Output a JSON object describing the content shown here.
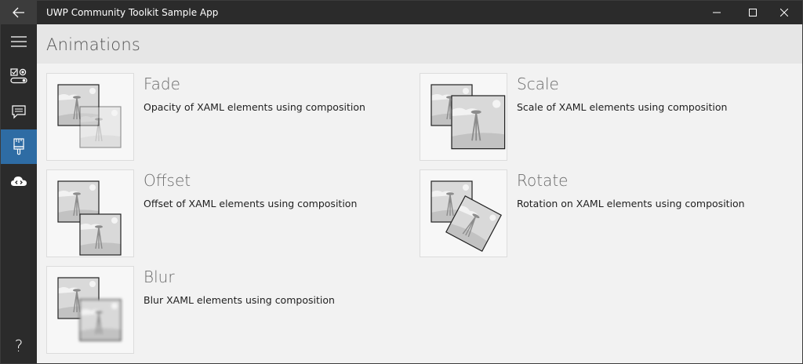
{
  "app": {
    "title": "UWP Community Toolkit Sample App"
  },
  "titlebar": {
    "back_icon": "arrow-left-icon",
    "minimize_icon": "minimize-icon",
    "maximize_icon": "maximize-icon",
    "close_icon": "close-icon"
  },
  "nav": {
    "items": [
      {
        "icon": "hamburger-menu-icon",
        "selected": false
      },
      {
        "icon": "controls-icon",
        "selected": false
      },
      {
        "icon": "notifications-icon",
        "selected": false
      },
      {
        "icon": "brush-icon",
        "selected": true
      },
      {
        "icon": "cloud-code-icon",
        "selected": false
      }
    ],
    "help_label": "?"
  },
  "header": {
    "title": "Animations"
  },
  "samples": [
    {
      "title": "Fade",
      "description": "Opacity of XAML elements using composition",
      "thumbnail": "fade"
    },
    {
      "title": "Scale",
      "description": "Scale of XAML elements using composition",
      "thumbnail": "scale"
    },
    {
      "title": "Offset",
      "description": "Offset of XAML elements using composition",
      "thumbnail": "offset"
    },
    {
      "title": "Rotate",
      "description": "Rotation on XAML elements using composition",
      "thumbnail": "rotate"
    },
    {
      "title": "Blur",
      "description": "Blur XAML elements using composition",
      "thumbnail": "blur"
    }
  ],
  "colors": {
    "titlebar_bg": "#2b2b2b",
    "nav_bg": "#2b2b2b",
    "nav_selected": "#2e6ca4",
    "header_bg": "#e6e6e6",
    "content_bg": "#f2f2f2"
  }
}
